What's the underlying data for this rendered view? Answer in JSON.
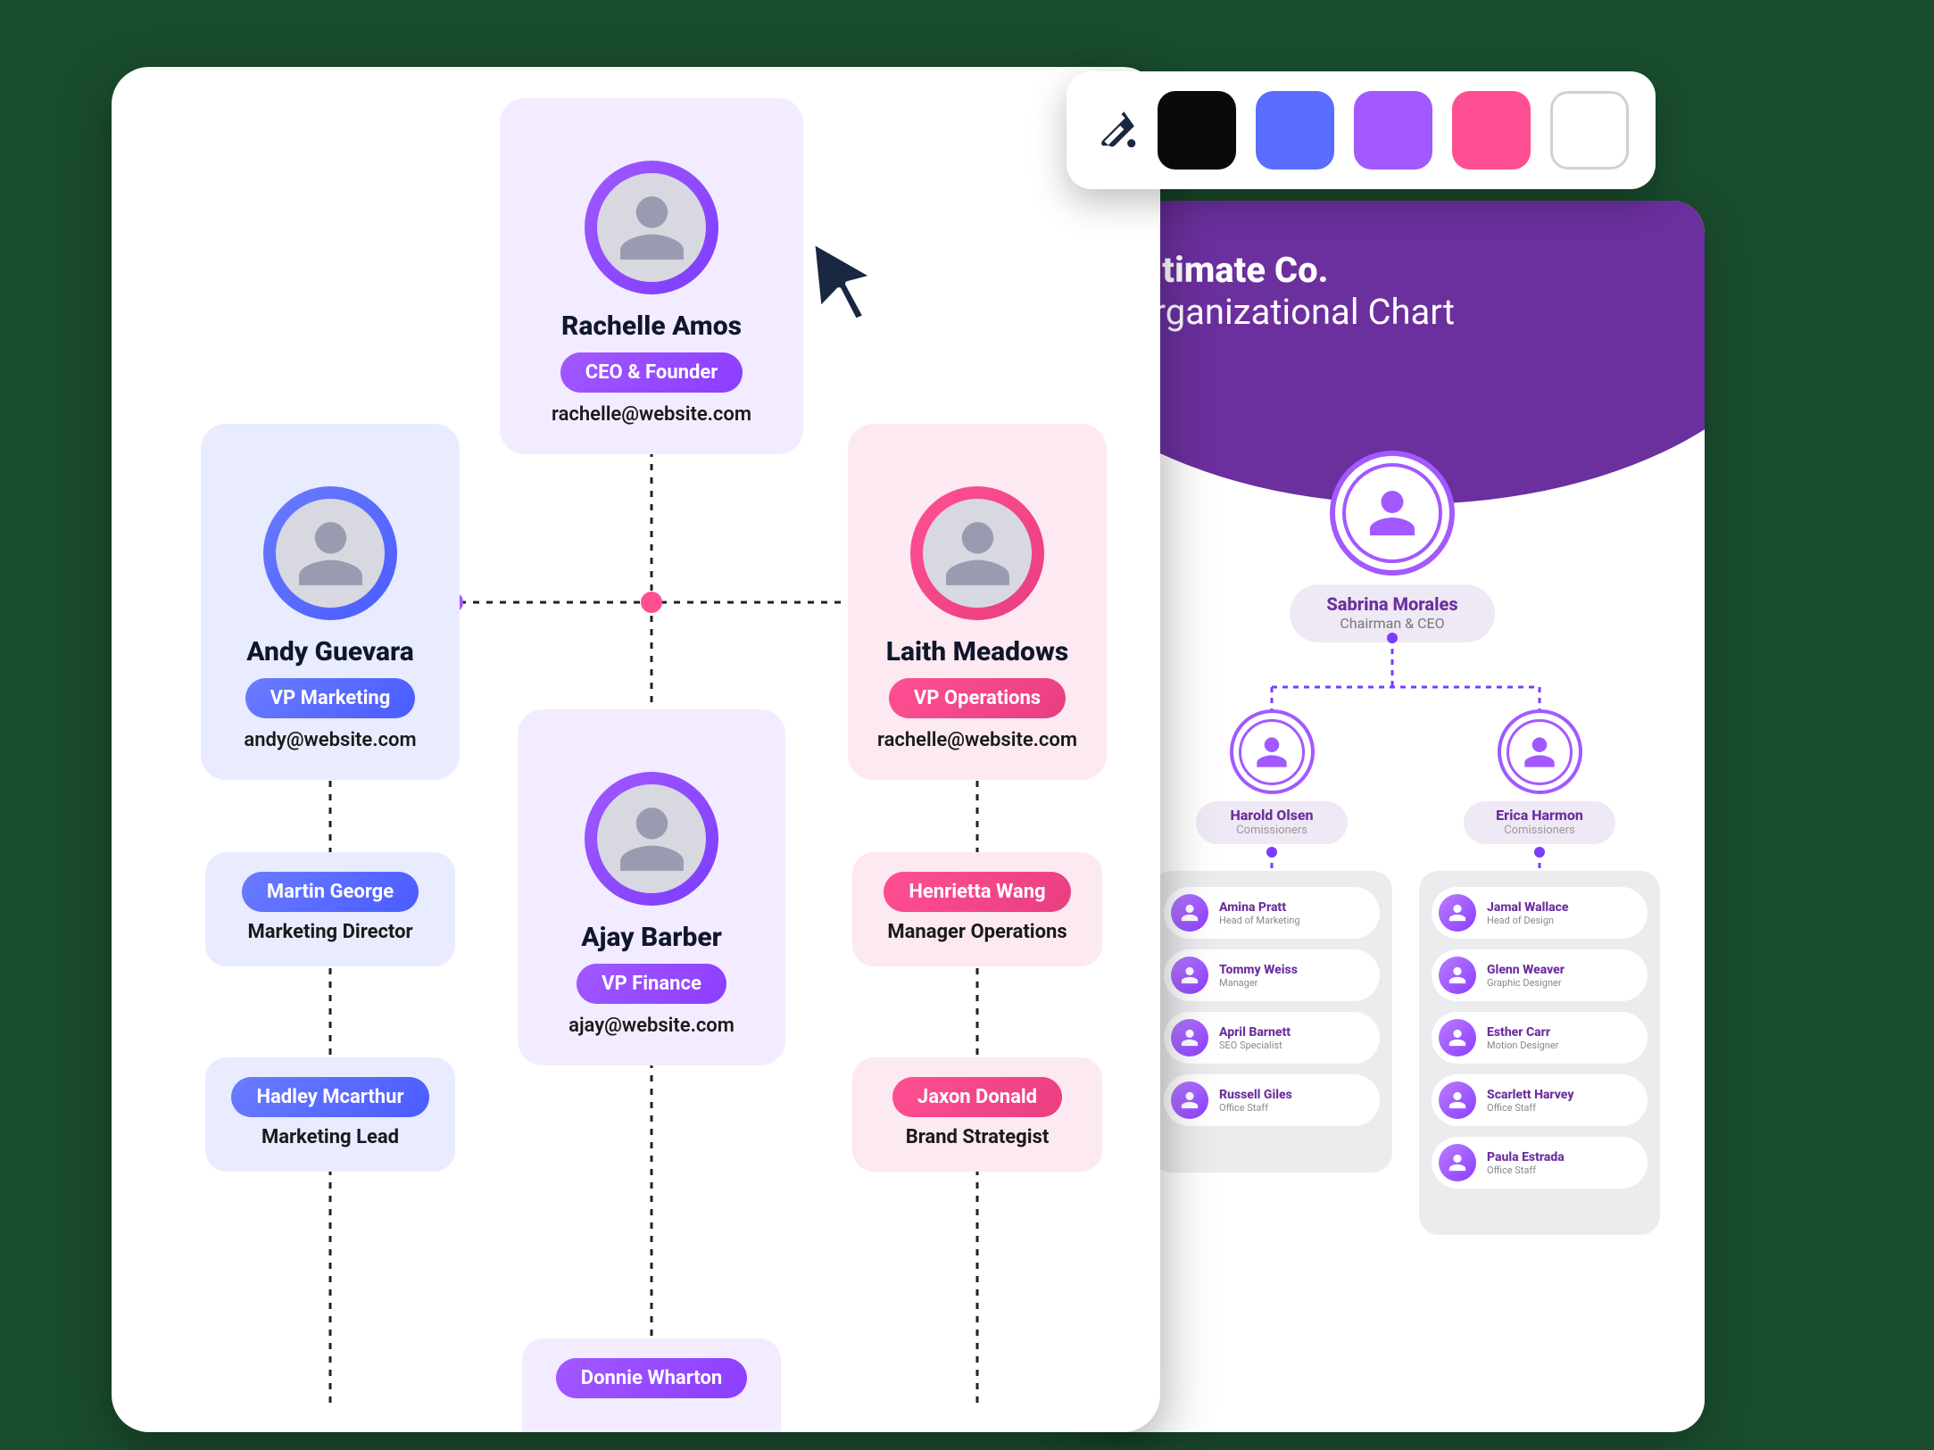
{
  "palette": {
    "colors": [
      "#0a0a0a",
      "#5a6dff",
      "#a259ff",
      "#ff4f93",
      "#ffffff"
    ]
  },
  "main": {
    "ceo": {
      "name": "Rachelle Amos",
      "role": "CEO & Founder",
      "email": "rachelle@website.com"
    },
    "left": {
      "name": "Andy Guevara",
      "role": "VP Marketing",
      "email": "andy@website.com",
      "subs": [
        {
          "name": "Martin George",
          "title": "Marketing Director"
        },
        {
          "name": "Hadley Mcarthur",
          "title": "Marketing Lead"
        }
      ]
    },
    "center": {
      "name": "Ajay Barber",
      "role": "VP Finance",
      "email": "ajay@website.com",
      "subs": [
        {
          "name": "Donnie Wharton",
          "title": ""
        }
      ]
    },
    "right": {
      "name": "Laith Meadows",
      "role": "VP Operations",
      "email": "rachelle@website.com",
      "subs": [
        {
          "name": "Henrietta Wang",
          "title": "Manager Operations"
        },
        {
          "name": "Jaxon Donald",
          "title": "Brand Strategist"
        }
      ]
    }
  },
  "secondary": {
    "title_line1": "Ultimate Co.",
    "title_line2": "Organizational Chart",
    "ceo": {
      "name": "Sabrina Morales",
      "role": "Chairman & CEO"
    },
    "commissioners": [
      {
        "name": "Harold Olsen",
        "role": "Comissioners"
      },
      {
        "name": "Erica Harmon",
        "role": "Comissioners"
      }
    ],
    "colA": [
      {
        "name": "Amina Pratt",
        "role": "Head of Marketing"
      },
      {
        "name": "Tommy Weiss",
        "role": "Manager"
      },
      {
        "name": "April Barnett",
        "role": "SEO Specialist"
      },
      {
        "name": "Russell Giles",
        "role": "Office Staff"
      }
    ],
    "colB": [
      {
        "name": "Jamal Wallace",
        "role": "Head of Design"
      },
      {
        "name": "Glenn Weaver",
        "role": "Graphic Designer"
      },
      {
        "name": "Esther Carr",
        "role": "Motion Designer"
      },
      {
        "name": "Scarlett Harvey",
        "role": "Office Staff"
      },
      {
        "name": "Paula Estrada",
        "role": "Office Staff"
      }
    ]
  }
}
